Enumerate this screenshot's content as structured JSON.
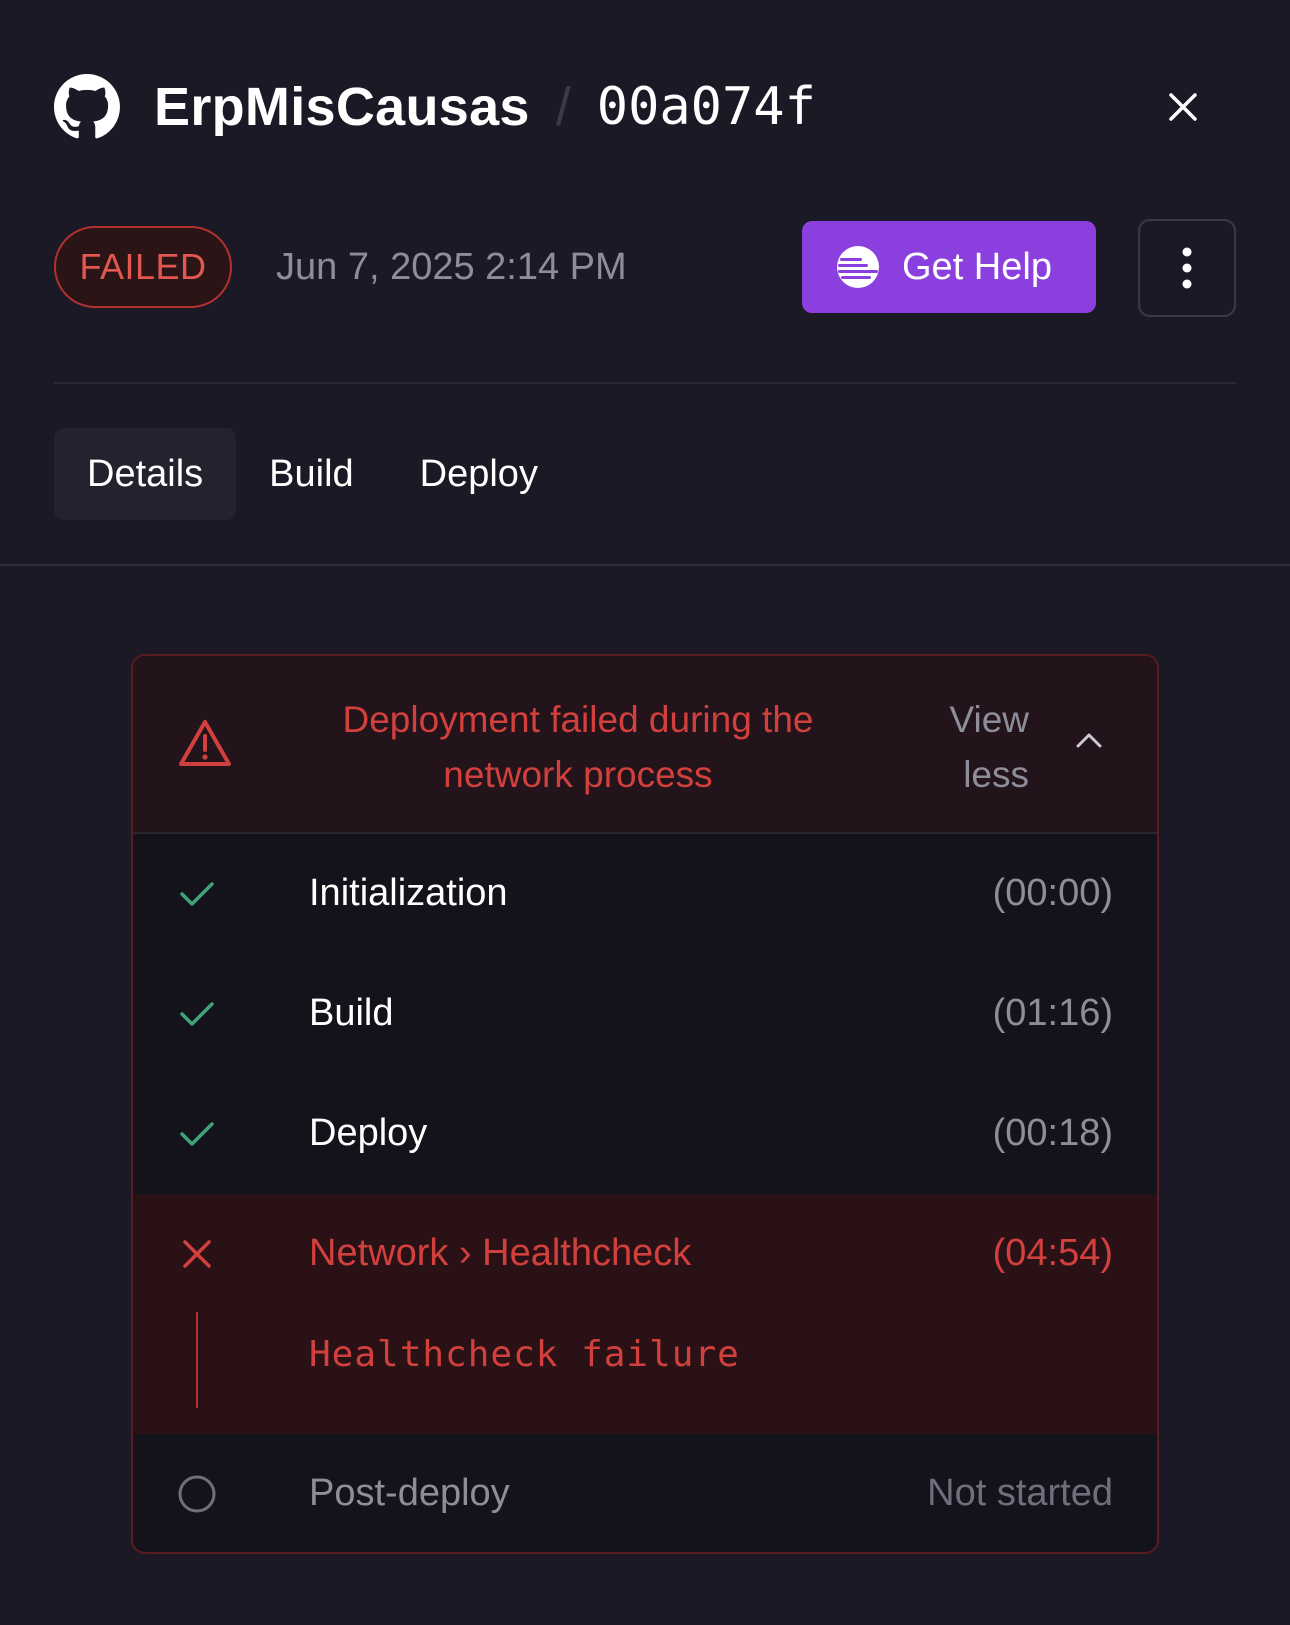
{
  "header": {
    "repo_name": "ErpMisCausas",
    "separator": "/",
    "commit": "00a074f",
    "icons": {
      "repo": "github-icon",
      "close": "close-icon"
    }
  },
  "status": {
    "badge": "FAILED",
    "timestamp": "Jun 7, 2025 2:14 PM",
    "help_label": "Get Help",
    "help_icon": "help-bot-icon",
    "more_icon": "more-vertical-icon"
  },
  "tabs": [
    {
      "label": "Details",
      "active": true
    },
    {
      "label": "Build",
      "active": false
    },
    {
      "label": "Deploy",
      "active": false
    }
  ],
  "error_card": {
    "title": "Deployment failed during the network process",
    "toggle": "View less",
    "icons": {
      "warning": "warning-triangle-icon",
      "toggle": "chevron-up-icon"
    },
    "steps": [
      {
        "label": "Initialization",
        "time": "(00:00)",
        "status": "success"
      },
      {
        "label": "Build",
        "time": "(01:16)",
        "status": "success"
      },
      {
        "label": "Deploy",
        "time": "(00:18)",
        "status": "success"
      },
      {
        "label": "Network › Healthcheck",
        "time": "(04:54)",
        "status": "failed",
        "message": "Healthcheck failure"
      },
      {
        "label": "Post-deploy",
        "time": "Not started",
        "status": "pending"
      }
    ]
  },
  "colors": {
    "background": "#1a1925",
    "accent": "#8b3fde",
    "error": "#d2403d",
    "success": "#3fa37a",
    "muted": "#8e8d9a"
  }
}
